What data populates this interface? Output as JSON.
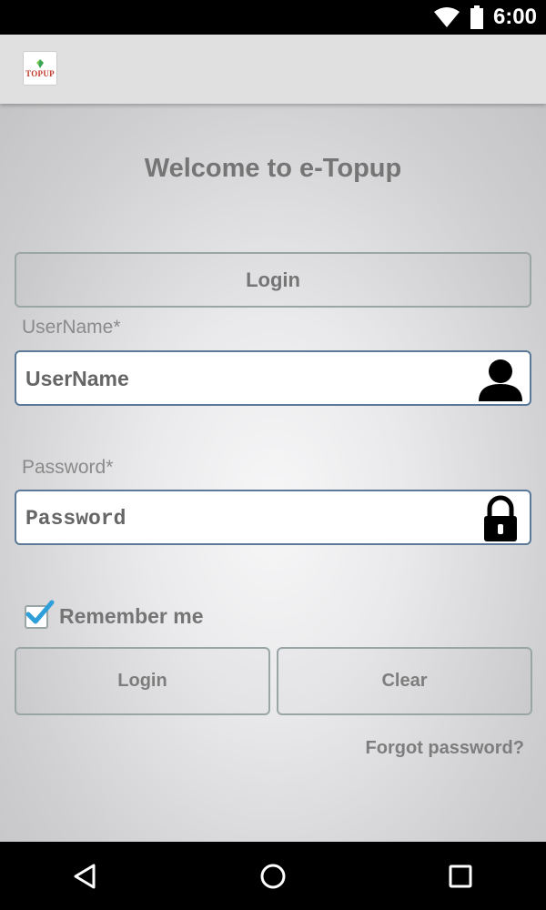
{
  "status_bar": {
    "time": "6:00",
    "icons": [
      "wifi-icon",
      "battery-icon"
    ]
  },
  "app_bar": {
    "logo_text": "TOPUP",
    "logo_icon": "leaf-logo-icon"
  },
  "main": {
    "title": "Welcome to e-Topup",
    "login_header_label": "Login",
    "username": {
      "label": "UserName*",
      "placeholder": "UserName",
      "value": "",
      "icon": "user-icon"
    },
    "password": {
      "label": "Password*",
      "placeholder": "Password",
      "value": "",
      "icon": "lock-icon"
    },
    "remember_me": {
      "label": "Remember me",
      "checked": true
    },
    "login_button_label": "Login",
    "clear_button_label": "Clear",
    "forgot_password_label": "Forgot password?"
  },
  "nav_bar": {
    "buttons": [
      "back-icon",
      "home-icon",
      "recents-icon"
    ]
  },
  "colors": {
    "check_blue": "#2e9fd8",
    "input_border": "#5b7a99",
    "button_border": "#9aa6a6",
    "text_gray": "#757575"
  }
}
